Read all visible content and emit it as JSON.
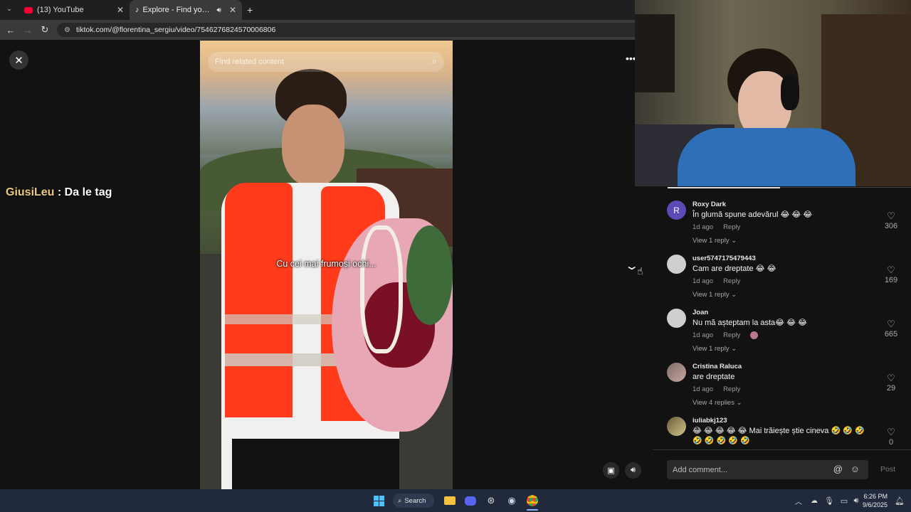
{
  "browser": {
    "tabs": [
      {
        "title": "(13) YouTube"
      },
      {
        "title": "Explore - Find your favourit"
      }
    ],
    "url": "tiktok.com/@florentina_sergiu/video/7546276824570006806"
  },
  "video": {
    "search_placeholder": "Find related content",
    "caption": "Cu cei mai frumoși ochi..."
  },
  "chat_overlay": {
    "user": "GiusiLeu",
    "message": ": Da le tag"
  },
  "comments": [
    {
      "user": "Roxy Dark",
      "avatar_letter": "R",
      "text": "În glumă spune adevărul 😂 😂 😂",
      "time": "1d ago",
      "reply": "Reply",
      "replies": "View 1 reply",
      "likes": "306"
    },
    {
      "user": "user5747175479443",
      "avatar_letter": "",
      "text": "Cam are dreptate 😂 😂",
      "time": "1d ago",
      "reply": "Reply",
      "replies": "View 1 reply",
      "likes": "169"
    },
    {
      "user": "Joan",
      "avatar_letter": "",
      "text": "Nu mă așteptam la asta😂 😂 😂",
      "time": "1d ago",
      "reply": "Reply",
      "replies": "View 1 reply",
      "likes": "665"
    },
    {
      "user": "Cristina Raluca",
      "avatar_letter": "",
      "text": "are dreptate",
      "time": "1d ago",
      "reply": "Reply",
      "replies": "View 4 replies",
      "likes": "29"
    },
    {
      "user": "iuliabkj123",
      "avatar_letter": "",
      "text": "😂 😂 😂 😂 😂 Mai trăiește știe cineva 🤣 🤣 🤣 🤣 🤣 🤣 🤣 🤣",
      "time": "",
      "reply": "",
      "replies": "",
      "likes": "0"
    }
  ],
  "comment_input": {
    "placeholder": "Add comment...",
    "post_label": "Post"
  },
  "taskbar": {
    "search_label": "Search",
    "time": "6:26 PM",
    "date": "9/6/2025"
  },
  "colors": {
    "accent_username": "#f0c978",
    "avatar_r": "#5b4bb7"
  }
}
